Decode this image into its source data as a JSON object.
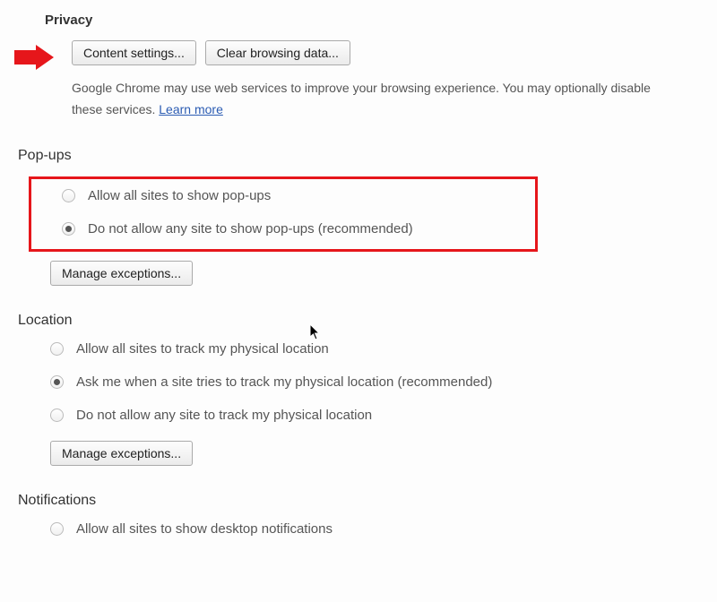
{
  "privacy": {
    "title": "Privacy",
    "content_settings_btn": "Content settings...",
    "clear_data_btn": "Clear browsing data...",
    "description_part1": "Google Chrome may use web services to improve your browsing experience. You may optionally disable these services. ",
    "learn_more": "Learn more"
  },
  "popups": {
    "title": "Pop-ups",
    "option_allow": "Allow all sites to show pop-ups",
    "option_block": "Do not allow any site to show pop-ups (recommended)",
    "selected": "block",
    "manage_btn": "Manage exceptions..."
  },
  "location": {
    "title": "Location",
    "option_allow": "Allow all sites to track my physical location",
    "option_ask": "Ask me when a site tries to track my physical location (recommended)",
    "option_block": "Do not allow any site to track my physical location",
    "selected": "ask",
    "manage_btn": "Manage exceptions..."
  },
  "notifications": {
    "title": "Notifications",
    "option_allow": "Allow all sites to show desktop notifications"
  },
  "colors": {
    "highlight_border": "#e6161b",
    "arrow": "#e6161b",
    "link": "#2b5cb3"
  }
}
